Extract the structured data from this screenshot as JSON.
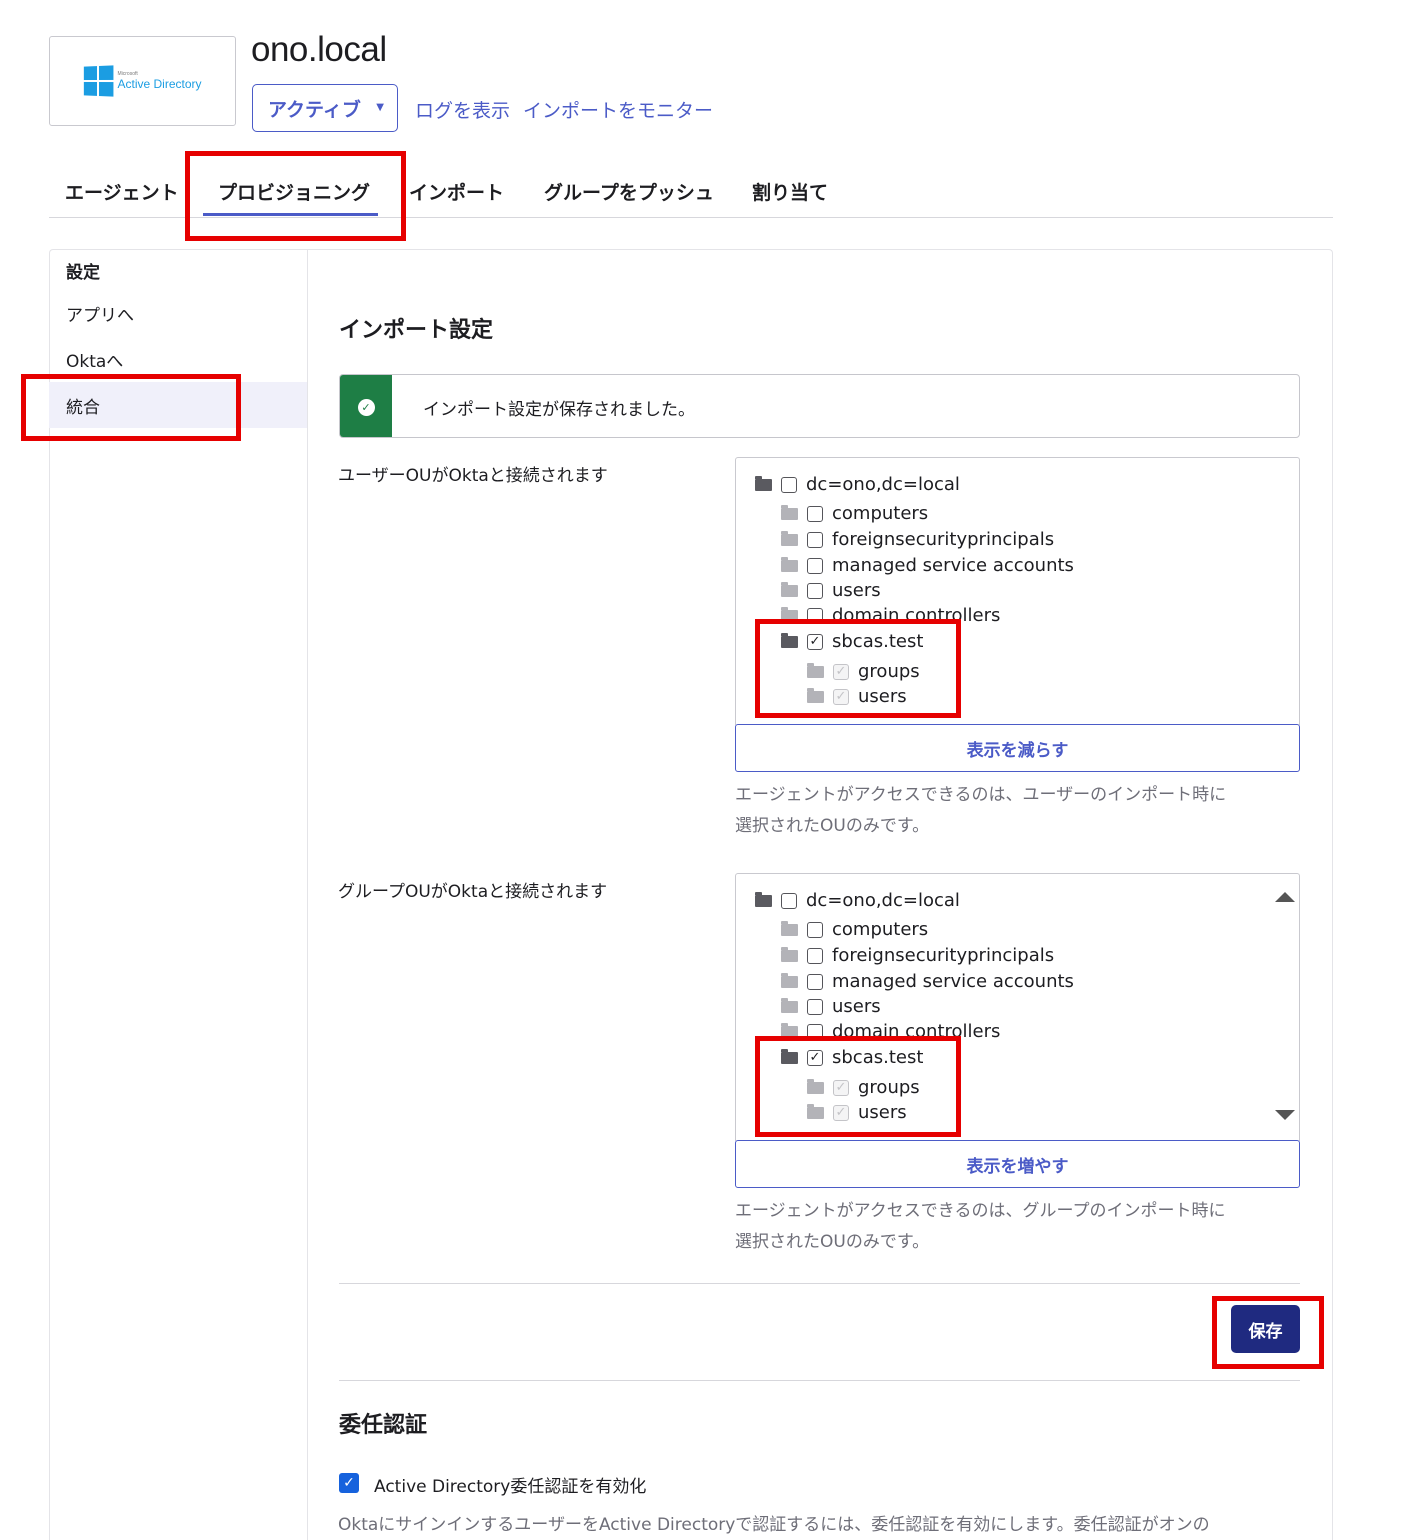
{
  "header": {
    "logo_text": "Active Directory",
    "logo_small": "Microsoft",
    "title": "ono.local",
    "status_label": "アクティブ",
    "view_logs_link": "ログを表示",
    "monitor_imports_link": "インポートをモニター"
  },
  "tabs": [
    {
      "label": "エージェント"
    },
    {
      "label": "プロビジョニング",
      "active": true
    },
    {
      "label": "インポート"
    },
    {
      "label": "グループをプッシュ"
    },
    {
      "label": "割り当て"
    }
  ],
  "sidebar": {
    "heading": "設定",
    "items": [
      {
        "label": "アプリへ"
      },
      {
        "label": "Oktaへ"
      },
      {
        "label": "統合",
        "active": true
      }
    ]
  },
  "import_settings": {
    "title": "インポート設定",
    "success_message": "インポート設定が保存されました。",
    "user_ou": {
      "label": "ユーザーOUがOktaと接続されます",
      "tree": [
        {
          "label": "dc=ono,dc=local",
          "checked": false
        },
        {
          "label": "computers",
          "checked": false
        },
        {
          "label": "foreignsecurityprincipals",
          "checked": false
        },
        {
          "label": "managed service accounts",
          "checked": false
        },
        {
          "label": "users",
          "checked": false
        },
        {
          "label": "domain controllers",
          "checked": false
        },
        {
          "label": "sbcas.test",
          "checked": true
        },
        {
          "label": "groups",
          "checked": true
        },
        {
          "label": "users",
          "checked": true
        }
      ],
      "toggle_label": "表示を減らす",
      "help_line1": "エージェントがアクセスできるのは、ユーザーのインポート時に",
      "help_line2": "選択されたOUのみです。"
    },
    "group_ou": {
      "label": "グループOUがOktaと接続されます",
      "tree": [
        {
          "label": "dc=ono,dc=local",
          "checked": false
        },
        {
          "label": "computers",
          "checked": false
        },
        {
          "label": "foreignsecurityprincipals",
          "checked": false
        },
        {
          "label": "managed service accounts",
          "checked": false
        },
        {
          "label": "users",
          "checked": false
        },
        {
          "label": "domain controllers",
          "checked": false
        },
        {
          "label": "sbcas.test",
          "checked": true
        },
        {
          "label": "groups",
          "checked": true
        },
        {
          "label": "users",
          "checked": true
        }
      ],
      "toggle_label": "表示を増やす",
      "help_line1": "エージェントがアクセスできるのは、グループのインポート時に",
      "help_line2": "選択されたOUのみです。"
    },
    "save_label": "保存"
  },
  "delegated_auth": {
    "title": "委任認証",
    "enable_label": "Active Directory委任認証を有効化",
    "enabled": true,
    "description": "OktaにサインインするユーザーをActive Directoryで認証するには、委任認証を有効にします。委任認証がオンの"
  },
  "colors": {
    "accent": "#4b5bc7",
    "save_button": "#1f2a80",
    "success": "#1e7e45",
    "highlight": "#e60000"
  }
}
